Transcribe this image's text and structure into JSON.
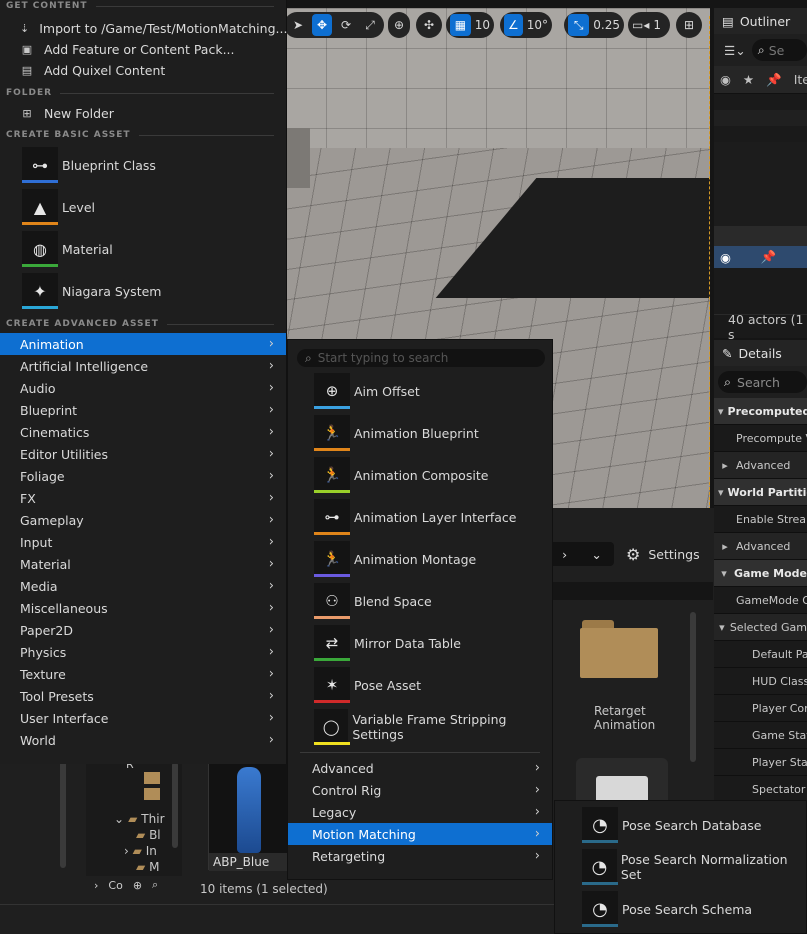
{
  "viewport_toolbar": {
    "grid_value": "10",
    "angle_value": "10°",
    "scale_value": "0.25",
    "camera_speed": "1"
  },
  "outliner": {
    "title": "Outliner",
    "search_placeholder": "Se",
    "column_label": "Ite",
    "status": "40 actors (1 s"
  },
  "details": {
    "title": "Details",
    "search_placeholder": "Search",
    "rows": [
      {
        "label": "Precomputed",
        "kind": "cat"
      },
      {
        "label": "Precompute V",
        "kind": "item"
      },
      {
        "label": "Advanced",
        "kind": "sub"
      },
      {
        "label": "World Partitio",
        "kind": "cat"
      },
      {
        "label": "Enable Stream",
        "kind": "item"
      },
      {
        "label": "Advanced",
        "kind": "sub"
      },
      {
        "label": "Game Mode",
        "kind": "cat"
      },
      {
        "label": "GameMode Ov",
        "kind": "item"
      },
      {
        "label": "Selected Gam",
        "kind": "sub"
      },
      {
        "label": "Default Paw",
        "kind": "item2"
      },
      {
        "label": "HUD Class",
        "kind": "item2"
      },
      {
        "label": "Player Con",
        "kind": "item2"
      },
      {
        "label": "Game Stat",
        "kind": "item2"
      },
      {
        "label": "Player Stat",
        "kind": "item2"
      },
      {
        "label": "Spectator C",
        "kind": "item2"
      }
    ]
  },
  "content_browser": {
    "settings_label": "Settings",
    "folder_label_1": "Retarget",
    "folder_label_2": "Animation",
    "asset_label": "ABP_Blue",
    "status": "10 items (1 selected)",
    "tree": [
      "R",
      "Thir",
      "Bl",
      "In",
      "M"
    ],
    "bottom_label": "Co"
  },
  "main_menu": {
    "sections": {
      "get_content": "GET CONTENT",
      "folder": "FOLDER",
      "basic": "CREATE BASIC ASSET",
      "advanced": "CREATE ADVANCED ASSET"
    },
    "get_content_items": [
      "Import to /Game/Test/MotionMatching...",
      "Add Feature or Content Pack...",
      "Add Quixel Content"
    ],
    "folder_items": [
      "New Folder"
    ],
    "basic_assets": [
      {
        "label": "Blueprint Class",
        "bar": "#2f6fd6"
      },
      {
        "label": "Level",
        "bar": "#e0851a"
      },
      {
        "label": "Material",
        "bar": "#3aa83a"
      },
      {
        "label": "Niagara System",
        "bar": "#2aa6d6"
      }
    ],
    "advanced_categories": [
      "Animation",
      "Artificial Intelligence",
      "Audio",
      "Blueprint",
      "Cinematics",
      "Editor Utilities",
      "Foliage",
      "FX",
      "Gameplay",
      "Input",
      "Material",
      "Media",
      "Miscellaneous",
      "Paper2D",
      "Physics",
      "Texture",
      "Tool Presets",
      "User Interface",
      "World"
    ],
    "selected_category": "Animation"
  },
  "animation_menu": {
    "search_placeholder": "Start typing to search",
    "assets": [
      {
        "label": "Aim Offset",
        "bar": "#3aa0e0"
      },
      {
        "label": "Animation Blueprint",
        "bar": "#e0851a"
      },
      {
        "label": "Animation Composite",
        "bar": "#9ad02a"
      },
      {
        "label": "Animation Layer Interface",
        "bar": "#e0851a"
      },
      {
        "label": "Animation Montage",
        "bar": "#6a5ae0"
      },
      {
        "label": "Blend Space",
        "bar": "#e89a6a"
      },
      {
        "label": "Mirror Data Table",
        "bar": "#3aa83a"
      },
      {
        "label": "Pose Asset",
        "bar": "#d02a2a"
      },
      {
        "label": "Variable Frame Stripping Settings",
        "bar": "#f0e020"
      }
    ],
    "submenus": [
      "Advanced",
      "Control Rig",
      "Legacy",
      "Motion Matching",
      "Retargeting"
    ],
    "selected_submenu": "Motion Matching"
  },
  "motion_matching_menu": {
    "assets": [
      {
        "label": "Pose Search Database",
        "bar": "#2a6a8a"
      },
      {
        "label": "Pose Search Normalization Set",
        "bar": "#2a6a8a"
      },
      {
        "label": "Pose Search Schema",
        "bar": "#2a6a8a"
      }
    ]
  },
  "colors": {
    "accent": "#0e6fd1",
    "menu_bg": "#1e1e1e"
  }
}
